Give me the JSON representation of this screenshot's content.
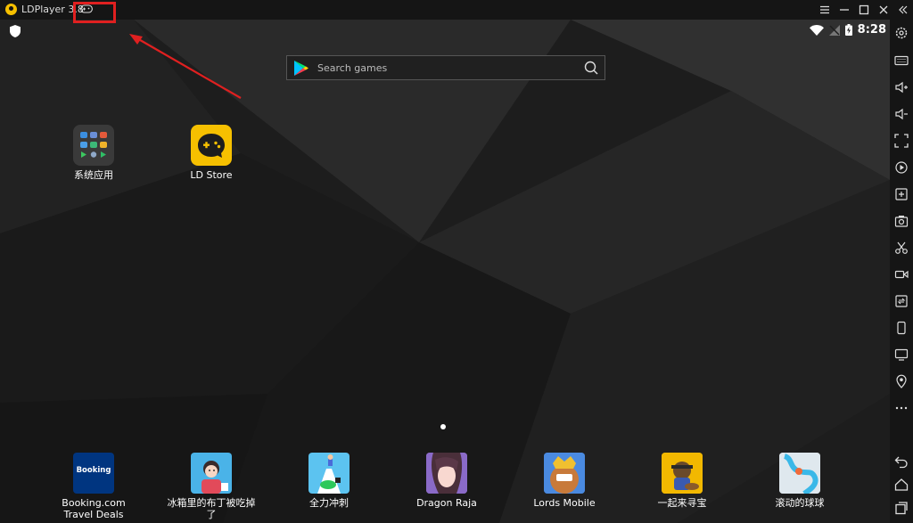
{
  "window": {
    "title": "LDPlayer 3.8"
  },
  "status_bar": {
    "time": "8:28"
  },
  "search": {
    "placeholder": "Search games"
  },
  "desktop_apps": [
    {
      "label": "系统应用",
      "icon": "folder-icon"
    },
    {
      "label": "LD Store",
      "icon": "gamepad-icon"
    }
  ],
  "dock_apps": [
    {
      "label": "Booking.com Travel Deals",
      "icon_text": "Booking",
      "color": "#003580"
    },
    {
      "label": "冰箱里的布丁被吃掉了",
      "color": "#4ab3e8"
    },
    {
      "label": "全力冲刺",
      "color": "#5cc3f0"
    },
    {
      "label": "Dragon Raja",
      "color": "#b48bd8"
    },
    {
      "label": "Lords Mobile",
      "color": "#3a7ad4"
    },
    {
      "label": "一起来寻宝",
      "color": "#f2b800"
    },
    {
      "label": "滚动的球球",
      "color": "#e8eef2"
    }
  ],
  "colors": {
    "accent_yellow": "#f6c000",
    "highlight_red": "#e02020"
  }
}
